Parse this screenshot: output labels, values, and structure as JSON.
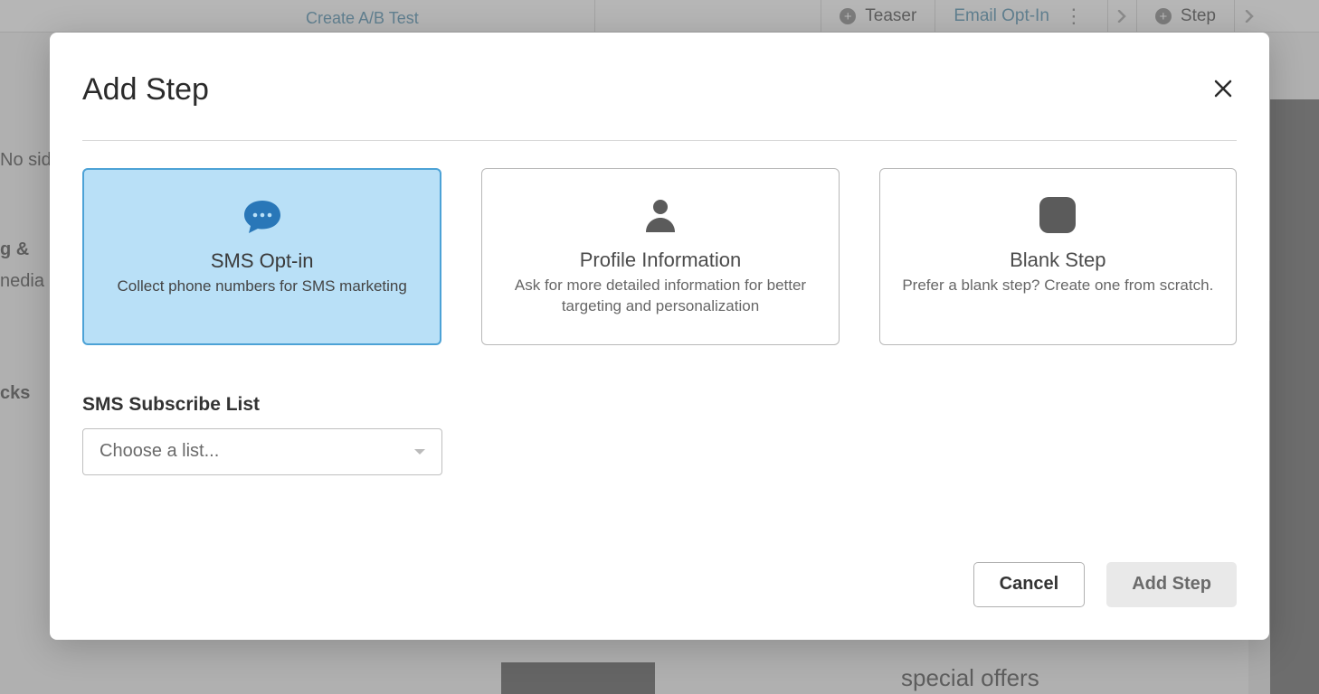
{
  "background": {
    "ab_test_link": "Create A/B Test",
    "tab_teaser": "Teaser",
    "tab_email_optin": "Email Opt-In",
    "tab_step": "Step",
    "sidebar_no_side": "No sid",
    "sidebar_g_amp": "g &",
    "sidebar_media": "nedia",
    "sidebar_cks": "cks",
    "bottom_special_offers": "special offers"
  },
  "modal": {
    "title": "Add Step",
    "options": {
      "sms": {
        "title": "SMS Opt-in",
        "desc": "Collect phone numbers for SMS marketing"
      },
      "profile": {
        "title": "Profile Information",
        "desc": "Ask for more detailed information for better targeting and personalization"
      },
      "blank": {
        "title": "Blank Step",
        "desc": "Prefer a blank step? Create one from scratch."
      }
    },
    "form": {
      "sms_list_label": "SMS Subscribe List",
      "sms_list_placeholder": "Choose a list..."
    },
    "footer": {
      "cancel": "Cancel",
      "add_step": "Add Step"
    }
  }
}
